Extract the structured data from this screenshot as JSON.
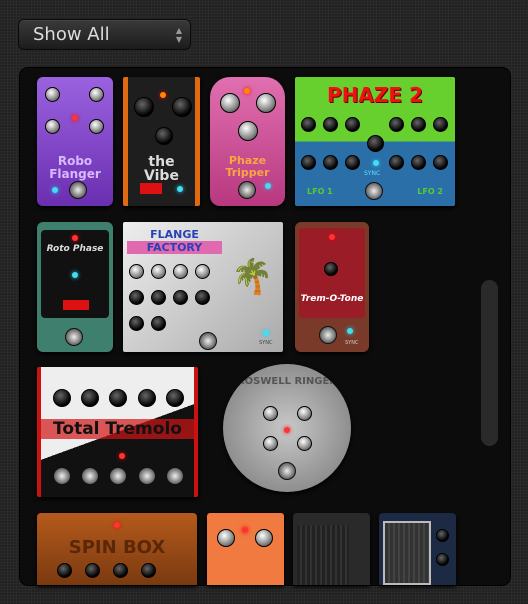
{
  "filter": {
    "selected": "Show All",
    "icon": "updown-chevron-icon"
  },
  "pedals": [
    {
      "name": "Robo Flanger",
      "color": "#7a3fc0"
    },
    {
      "name": "the Vibe",
      "color": "#1e1e1e"
    },
    {
      "name": "Phaze Tripper",
      "color": "#c84a93"
    },
    {
      "name": "PHAZE 2",
      "color": "#5bc52a",
      "labels": [
        "LFO 1",
        "LFO 2",
        "SYNC"
      ]
    },
    {
      "name": "Roto Phase",
      "color": "#3e7f6d"
    },
    {
      "name": "FLANGE FACTORY",
      "color": "#cfcfcf",
      "labels": [
        "SYNC"
      ]
    },
    {
      "name": "Trem-O-Tone",
      "color": "#8a1a22",
      "labels": [
        "SYNC"
      ]
    },
    {
      "name": "Total Tremolo",
      "color": "#d41b1b"
    },
    {
      "name": "ROSWELL RINGER",
      "color": "#9a9a9a"
    },
    {
      "name": "SPIN BOX",
      "color": "#9a4a16"
    },
    {
      "name": "",
      "color": "#f07a40"
    },
    {
      "name": "",
      "color": "#2a2a2a"
    },
    {
      "name": "",
      "color": "#1c2a44"
    }
  ]
}
